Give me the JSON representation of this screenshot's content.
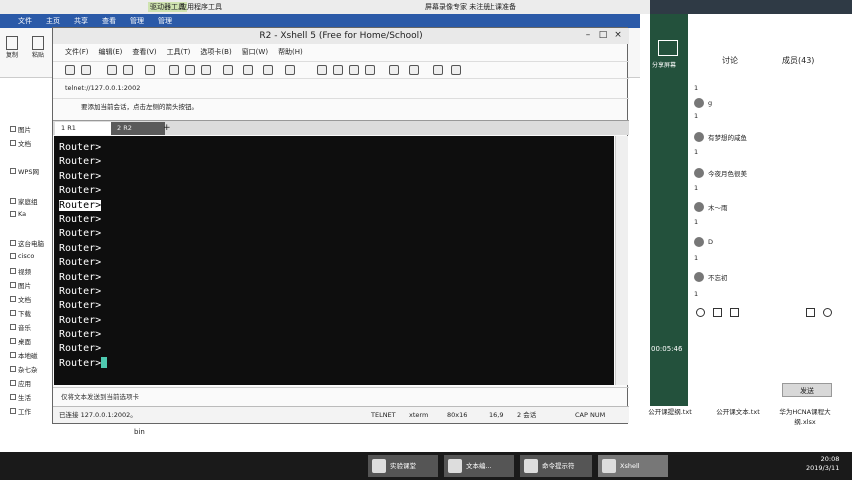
{
  "explorer": {
    "title_center": "上课准备",
    "title_left_tab1": "驱动器工具",
    "title_left_tab2": "应用程序工具",
    "title_right_1": "屏幕录像专家 未注册",
    "ribbon_tabs": [
      "文件",
      "主页",
      "共享",
      "查看",
      "管理",
      "管理"
    ],
    "ribbon_buttons": [
      "复制",
      "粘贴"
    ],
    "nav_items": [
      "图片",
      "文档",
      "WPS网",
      "家庭组",
      "Ka",
      "这台电脑",
      "cisco",
      "视频",
      "图片",
      "文档",
      "下载",
      "音乐",
      "桌面",
      "本地磁",
      "杂七杂",
      "应用",
      "生活",
      "工作"
    ],
    "bin_label": "bin"
  },
  "xshell": {
    "title": "R2 - Xshell 5 (Free for Home/School)",
    "menu": [
      "文件(F)",
      "编辑(E)",
      "查看(V)",
      "工具(T)",
      "选项卡(B)",
      "窗口(W)",
      "帮助(H)"
    ],
    "address": "telnet://127.0.0.1:2002",
    "hint": "要添加当前会话，点击左侧的箭头按钮。",
    "tabs": [
      "1 R1",
      "2 R2"
    ],
    "tab_add": "+",
    "terminal_lines": [
      "Router>",
      "Router>",
      "Router>",
      "Router>",
      "Router>",
      "Router>",
      "Router>",
      "Router>",
      "Router>",
      "Router>",
      "Router>",
      "Router>",
      "Router>",
      "Router>",
      "Router>",
      "Router>"
    ],
    "compose_placeholder": "仅将文本发送到当前选项卡",
    "status": {
      "connection": "已连接 127.0.0.1:2002。",
      "protocol": "TELNET",
      "term": "xterm",
      "size": "80x16",
      "cursor_pos": "16,9",
      "sessions": "2 会话",
      "caps": "CAP NUM"
    }
  },
  "chat": {
    "share_label": "分享屏幕",
    "tab_discuss": "讨论",
    "tab_members": "成员(43)",
    "entries": [
      {
        "num": "1",
        "name": ""
      },
      {
        "num": "1",
        "name": "g"
      },
      {
        "num": "1",
        "name": "有梦想的咸鱼"
      },
      {
        "num": "1",
        "name": "今夜月色很美"
      },
      {
        "num": "1",
        "name": "木～雨"
      },
      {
        "num": "1",
        "name": "D"
      },
      {
        "num": "1",
        "name": "不忘初"
      }
    ],
    "timer": "00:05:46",
    "send_label": "发送"
  },
  "desktop_files": [
    "公开课提纲.txt",
    "公开课文本.txt",
    "华为HCNA课程大纲.xlsx"
  ],
  "taskbar": {
    "items": [
      "实验课堂",
      "文本编...",
      "命令提示符",
      "Xshell"
    ],
    "time": "20:08",
    "date": "2019/3/11"
  }
}
